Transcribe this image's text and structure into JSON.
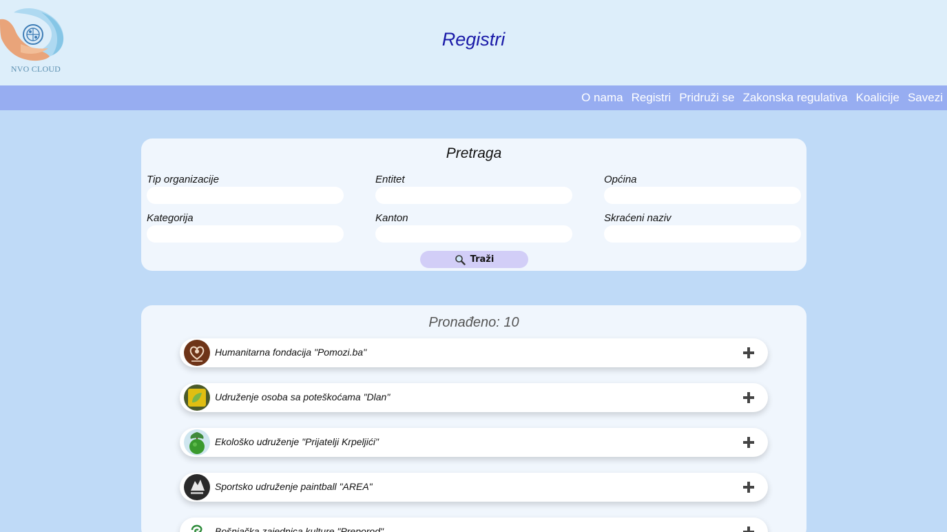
{
  "header": {
    "logo_text": "NVO CLOUD",
    "title": "Registri"
  },
  "nav": {
    "items": [
      "O nama",
      "Registri",
      "Pridruži se",
      "Zakonska regulativa",
      "Koalicije",
      "Savezi"
    ]
  },
  "search": {
    "title": "Pretraga",
    "fields": {
      "tip_organizacije": {
        "label": "Tip organizacije",
        "value": ""
      },
      "entitet": {
        "label": "Entitet",
        "value": ""
      },
      "opcina": {
        "label": "Općina",
        "value": ""
      },
      "kategorija": {
        "label": "Kategorija",
        "value": ""
      },
      "kanton": {
        "label": "Kanton",
        "value": ""
      },
      "skraceni_naziv": {
        "label": "Skraćeni naziv",
        "value": ""
      }
    },
    "button_label": "Traži",
    "button_icon": "magnifier-icon"
  },
  "results": {
    "title": "Pronađeno: 10",
    "items": [
      {
        "name": "Humanitarna fondacija \"Pomozi.ba\"",
        "logo": "pomozi-logo",
        "logo_color": "#7a3a1e"
      },
      {
        "name": "Udruženje osoba sa poteškoćama \"Dlan\"",
        "logo": "dlan-logo",
        "logo_color": "#d8b400"
      },
      {
        "name": "Ekološko udruženje \"Prijatelji Krpeljići\"",
        "logo": "globe-tree-logo",
        "logo_color": "#3d8f2e"
      },
      {
        "name": "Sportsko udruženje paintball \"AREA\"",
        "logo": "area-logo",
        "logo_color": "#2a2a2a"
      },
      {
        "name": "Bošnjačka zajednica kulture \"Preporod\"",
        "logo": "preporod-logo",
        "logo_color": "#2e8b3a"
      }
    ],
    "expand_icon": "plus-icon"
  }
}
